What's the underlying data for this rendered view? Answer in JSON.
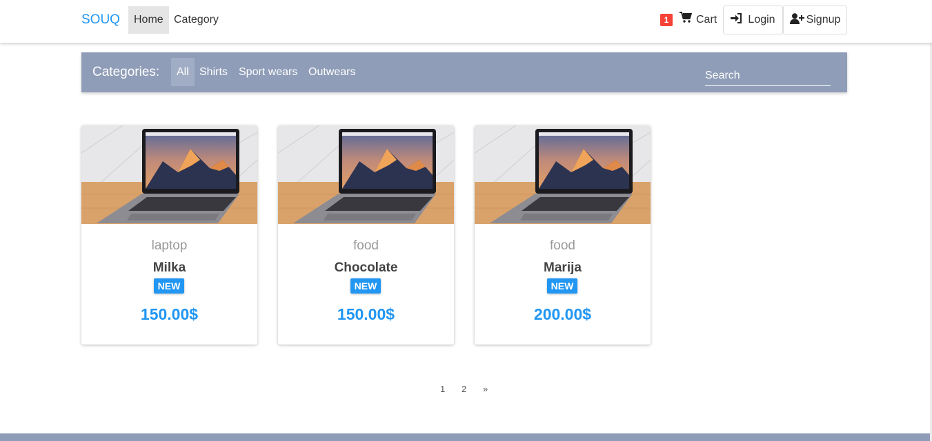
{
  "navbar": {
    "brand": "SOUQ",
    "home": "Home",
    "category": "Category",
    "cart_count": "1",
    "cart": "Cart",
    "login": "Login",
    "signup": "Signup"
  },
  "categories": {
    "title": "Categories:",
    "items": [
      "All",
      "Shirts",
      "Sport wears",
      "Outwears"
    ],
    "active": "All",
    "search_placeholder": "Search"
  },
  "products": [
    {
      "category": "laptop",
      "name": "Milka",
      "badge": "NEW",
      "price": "150.00$",
      "image": "laptop-photo"
    },
    {
      "category": "food",
      "name": "Chocolate",
      "badge": "NEW",
      "price": "150.00$",
      "image": "laptop-photo"
    },
    {
      "category": "food",
      "name": "Marija",
      "badge": "NEW",
      "price": "200.00$",
      "image": "laptop-photo"
    }
  ],
  "pagination": {
    "pages": [
      "1",
      "2"
    ],
    "next": "»"
  },
  "colors": {
    "accent": "#2196f3",
    "bar": "#8f9db8",
    "badge_red": "#f44336"
  }
}
